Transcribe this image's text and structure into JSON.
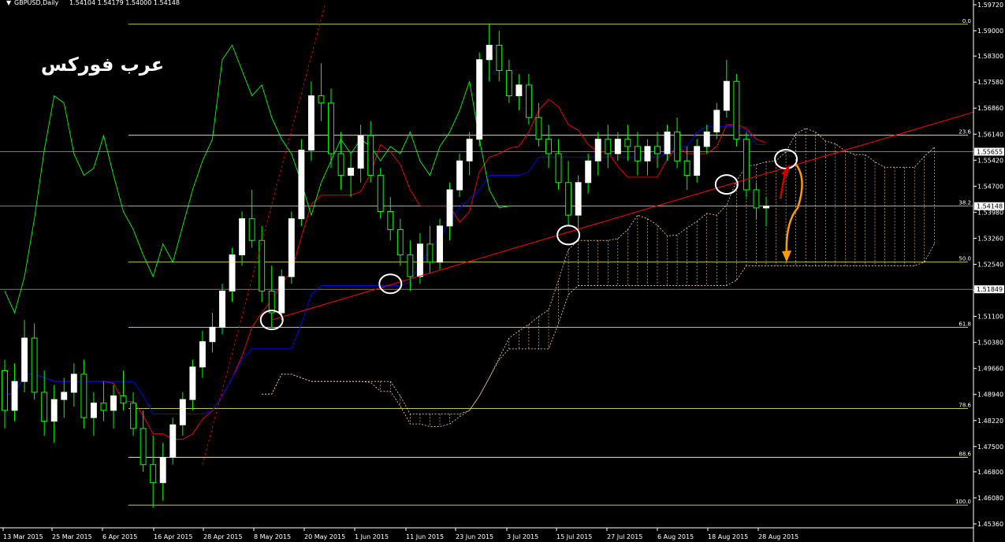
{
  "header": {
    "symbol": "GBPUSD,Daily",
    "ohlc": "1.54104 1.54179 1.54000 1.54148"
  },
  "logo_text": "عرب فوركس",
  "colors": {
    "background": "#000000",
    "bull_candle": "#ffffff",
    "bear_candle": "#00ff00",
    "wick": "#00ff00",
    "chikou": "#00ff00",
    "tenkan": "#ff0000",
    "kijun": "#0000ff",
    "fib_line": "#ffff80",
    "price_line": "#c0c0c0",
    "trendline": "#ff0000",
    "up_arrow": "#cc0000",
    "down_arrow": "#ff9900",
    "cloud": "#ffd0a0"
  },
  "chart_data": {
    "type": "candlestick",
    "symbol": "GBPUSD",
    "timeframe": "Daily",
    "ylim": [
      1.4536,
      1.5972
    ],
    "y_ticks": [
      "1.59720",
      "1.59000",
      "1.58300",
      "1.57580",
      "1.56860",
      "1.56140",
      "1.55420",
      "1.54700",
      "1.53980",
      "1.53260",
      "1.52540",
      "1.51820",
      "1.51100",
      "1.50380",
      "1.49660",
      "1.48940",
      "1.48220",
      "1.47500",
      "1.46800",
      "1.46080",
      "1.45360"
    ],
    "x_ticks": [
      "13 Mar 2015",
      "25 Mar 2015",
      "6 Apr 2015",
      "16 Apr 2015",
      "28 Apr 2015",
      "8 May 2015",
      "20 May 2015",
      "1 Jun 2015",
      "11 Jun 2015",
      "23 Jun 2015",
      "3 Jul 2015",
      "15 Jul 2015",
      "27 Jul 2015",
      "6 Aug 2015",
      "18 Aug 2015",
      "28 Aug 2015"
    ],
    "price_labels": [
      {
        "value": 1.55655,
        "label": "1.55655"
      },
      {
        "value": 1.54148,
        "label": "1.54148"
      },
      {
        "value": 1.51849,
        "label": "1.51849"
      }
    ],
    "fibonacci": [
      {
        "level": "0.0",
        "price": 1.5918
      },
      {
        "level": "23.6",
        "price": 1.5611
      },
      {
        "level": "38.2",
        "price": 1.5415
      },
      {
        "level": "50.0",
        "price": 1.526
      },
      {
        "level": "61.8",
        "price": 1.508
      },
      {
        "level": "78.6",
        "price": 1.4855
      },
      {
        "level": "88.6",
        "price": 1.472
      },
      {
        "level": "100.0",
        "price": 1.4588
      }
    ],
    "ohlc": [
      [
        1.496,
        1.499,
        1.48,
        1.485
      ],
      [
        1.485,
        1.498,
        1.482,
        1.493
      ],
      [
        1.493,
        1.51,
        1.49,
        1.505
      ],
      [
        1.505,
        1.509,
        1.488,
        1.49
      ],
      [
        1.49,
        1.496,
        1.478,
        1.482
      ],
      [
        1.482,
        1.492,
        1.476,
        1.488
      ],
      [
        1.488,
        1.494,
        1.483,
        1.49
      ],
      [
        1.49,
        1.498,
        1.486,
        1.495
      ],
      [
        1.495,
        1.499,
        1.48,
        1.483
      ],
      [
        1.483,
        1.49,
        1.478,
        1.487
      ],
      [
        1.487,
        1.493,
        1.482,
        1.485
      ],
      [
        1.485,
        1.492,
        1.48,
        1.489
      ],
      [
        1.489,
        1.496,
        1.485,
        1.487
      ],
      [
        1.487,
        1.49,
        1.478,
        1.48
      ],
      [
        1.48,
        1.485,
        1.468,
        1.47
      ],
      [
        1.47,
        1.478,
        1.458,
        1.465
      ],
      [
        1.465,
        1.476,
        1.46,
        1.472
      ],
      [
        1.472,
        1.483,
        1.47,
        1.481
      ],
      [
        1.481,
        1.49,
        1.478,
        1.488
      ],
      [
        1.488,
        1.499,
        1.485,
        1.497
      ],
      [
        1.497,
        1.507,
        1.494,
        1.504
      ],
      [
        1.504,
        1.512,
        1.501,
        1.508
      ],
      [
        1.508,
        1.52,
        1.506,
        1.518
      ],
      [
        1.518,
        1.53,
        1.515,
        1.528
      ],
      [
        1.528,
        1.54,
        1.525,
        1.538
      ],
      [
        1.538,
        1.546,
        1.53,
        1.532
      ],
      [
        1.532,
        1.536,
        1.515,
        1.518
      ],
      [
        1.518,
        1.525,
        1.508,
        1.512
      ],
      [
        1.512,
        1.524,
        1.51,
        1.522
      ],
      [
        1.522,
        1.54,
        1.52,
        1.538
      ],
      [
        1.538,
        1.56,
        1.536,
        1.557
      ],
      [
        1.557,
        1.576,
        1.554,
        1.572
      ],
      [
        1.572,
        1.581,
        1.565,
        1.57
      ],
      [
        1.57,
        1.574,
        1.552,
        1.556
      ],
      [
        1.556,
        1.562,
        1.546,
        1.55
      ],
      [
        1.55,
        1.556,
        1.544,
        1.552
      ],
      [
        1.552,
        1.564,
        1.548,
        1.561
      ],
      [
        1.561,
        1.565,
        1.548,
        1.55
      ],
      [
        1.55,
        1.552,
        1.538,
        1.54
      ],
      [
        1.54,
        1.544,
        1.532,
        1.535
      ],
      [
        1.535,
        1.538,
        1.525,
        1.528
      ],
      [
        1.528,
        1.532,
        1.518,
        1.522
      ],
      [
        1.522,
        1.534,
        1.52,
        1.531
      ],
      [
        1.531,
        1.536,
        1.523,
        1.526
      ],
      [
        1.526,
        1.538,
        1.524,
        1.536
      ],
      [
        1.536,
        1.548,
        1.532,
        1.546
      ],
      [
        1.546,
        1.556,
        1.544,
        1.554
      ],
      [
        1.554,
        1.562,
        1.55,
        1.56
      ],
      [
        1.56,
        1.584,
        1.558,
        1.582
      ],
      [
        1.582,
        1.592,
        1.576,
        1.586
      ],
      [
        1.586,
        1.59,
        1.576,
        1.579
      ],
      [
        1.579,
        1.582,
        1.57,
        1.572
      ],
      [
        1.572,
        1.578,
        1.568,
        1.575
      ],
      [
        1.575,
        1.578,
        1.564,
        1.566
      ],
      [
        1.566,
        1.57,
        1.558,
        1.56
      ],
      [
        1.56,
        1.564,
        1.552,
        1.556
      ],
      [
        1.556,
        1.56,
        1.546,
        1.548
      ],
      [
        1.548,
        1.554,
        1.536,
        1.539
      ],
      [
        1.539,
        1.55,
        1.535,
        1.548
      ],
      [
        1.548,
        1.556,
        1.545,
        1.554
      ],
      [
        1.554,
        1.562,
        1.55,
        1.56
      ],
      [
        1.56,
        1.564,
        1.552,
        1.556
      ],
      [
        1.556,
        1.562,
        1.554,
        1.56
      ],
      [
        1.56,
        1.564,
        1.554,
        1.558
      ],
      [
        1.558,
        1.562,
        1.55,
        1.554
      ],
      [
        1.554,
        1.56,
        1.55,
        1.558
      ],
      [
        1.558,
        1.562,
        1.552,
        1.556
      ],
      [
        1.556,
        1.564,
        1.554,
        1.562
      ],
      [
        1.562,
        1.566,
        1.552,
        1.554
      ],
      [
        1.554,
        1.558,
        1.546,
        1.55
      ],
      [
        1.55,
        1.56,
        1.548,
        1.558
      ],
      [
        1.558,
        1.564,
        1.556,
        1.562
      ],
      [
        1.562,
        1.57,
        1.56,
        1.568
      ],
      [
        1.568,
        1.582,
        1.566,
        1.576
      ],
      [
        1.576,
        1.578,
        1.558,
        1.56
      ],
      [
        1.56,
        1.562,
        1.544,
        1.546
      ],
      [
        1.546,
        1.548,
        1.538,
        1.541
      ],
      [
        1.541,
        1.544,
        1.536,
        1.5415
      ]
    ],
    "annotations": [
      "trendline",
      "5 circles marking trendline touches",
      "red up arrow",
      "orange curved down arrow"
    ]
  }
}
